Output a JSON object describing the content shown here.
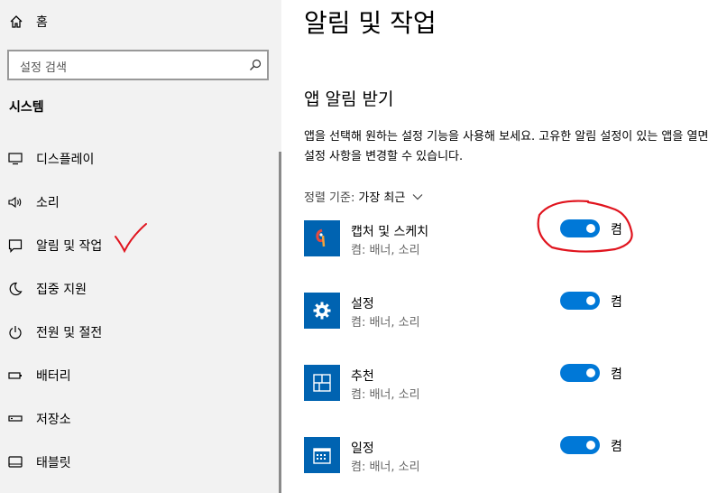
{
  "sidebar": {
    "home_label": "홈",
    "search_placeholder": "설정 검색",
    "category": "시스템",
    "items": [
      {
        "label": "디스플레이",
        "icon": "display-icon"
      },
      {
        "label": "소리",
        "icon": "speaker-icon"
      },
      {
        "label": "알림 및 작업",
        "icon": "message-icon"
      },
      {
        "label": "집중 지원",
        "icon": "moon-icon"
      },
      {
        "label": "전원 및 절전",
        "icon": "power-icon"
      },
      {
        "label": "배터리",
        "icon": "battery-icon"
      },
      {
        "label": "저장소",
        "icon": "storage-icon"
      },
      {
        "label": "태블릿",
        "icon": "tablet-icon"
      }
    ]
  },
  "main": {
    "title": "알림 및 작업",
    "section_title": "앱 알림 받기",
    "description": "앱을 선택해 원하는 설정 기능을 사용해 보세요. 고유한 알림 설정이 있는 앱을 열면 설정 사항을 변경할 수 있습니다.",
    "sort_label": "정렬 기준:",
    "sort_value": "가장 최근",
    "apps": [
      {
        "name": "캡처 및 스케치",
        "subtitle": "켬: 배너, 소리",
        "state": "켬",
        "on": true,
        "icon": "snip-sketch-icon"
      },
      {
        "name": "설정",
        "subtitle": "켬: 배너, 소리",
        "state": "켬",
        "on": true,
        "icon": "settings-gear-icon"
      },
      {
        "name": "추천",
        "subtitle": "켬: 배너, 소리",
        "state": "켬",
        "on": true,
        "icon": "suggestions-icon"
      },
      {
        "name": "일정",
        "subtitle": "켬: 배너, 소리",
        "state": "켬",
        "on": true,
        "icon": "calendar-icon"
      }
    ]
  },
  "colors": {
    "accent": "#0078d7",
    "tile": "#0063b1",
    "annotation": "#e0141e"
  }
}
